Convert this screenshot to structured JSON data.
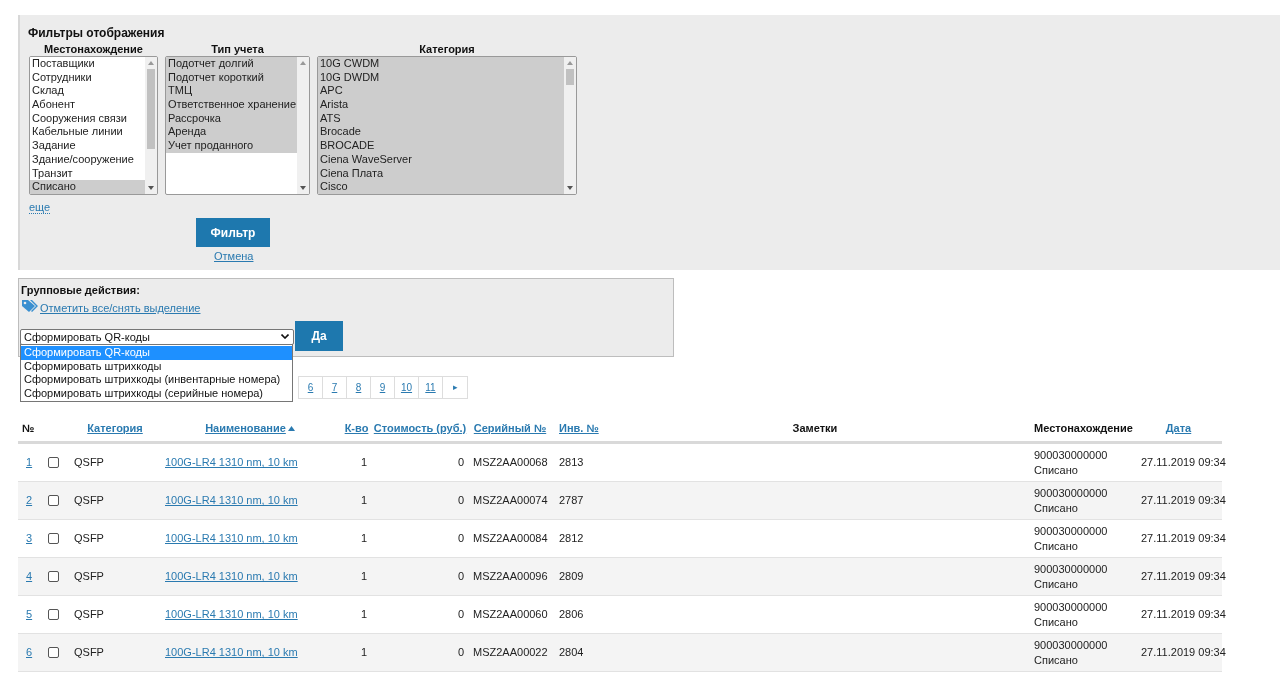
{
  "filters": {
    "title": "Фильтры отображения",
    "lists": [
      {
        "label": "Местонахождение",
        "items": [
          {
            "text": "Поставщики",
            "selected": false
          },
          {
            "text": "Сотрудники",
            "selected": false
          },
          {
            "text": "Склад",
            "selected": false
          },
          {
            "text": "Абонент",
            "selected": false
          },
          {
            "text": "Сооружения связи",
            "selected": false
          },
          {
            "text": "Кабельные линии",
            "selected": false
          },
          {
            "text": "Задание",
            "selected": false
          },
          {
            "text": "Здание/сооружение",
            "selected": false
          },
          {
            "text": "Транзит",
            "selected": false
          },
          {
            "text": "Списано",
            "selected": true
          }
        ]
      },
      {
        "label": "Тип учета",
        "items": [
          {
            "text": "Подотчет долгий",
            "selected": true
          },
          {
            "text": "Подотчет короткий",
            "selected": true
          },
          {
            "text": "ТМЦ",
            "selected": true
          },
          {
            "text": "Ответственное хранение",
            "selected": true
          },
          {
            "text": "Рассрочка",
            "selected": true
          },
          {
            "text": "Аренда",
            "selected": true
          },
          {
            "text": "Учет проданного",
            "selected": true
          }
        ]
      },
      {
        "label": "Категория",
        "items": [
          {
            "text": "10G CWDM",
            "selected": true
          },
          {
            "text": "10G DWDM",
            "selected": true
          },
          {
            "text": "APC",
            "selected": true
          },
          {
            "text": "Arista",
            "selected": true
          },
          {
            "text": "ATS",
            "selected": true
          },
          {
            "text": "Brocade",
            "selected": true
          },
          {
            "text": "BROCADE",
            "selected": true
          },
          {
            "text": "Ciena WaveServer",
            "selected": true
          },
          {
            "text": "Ciena Плата",
            "selected": true
          },
          {
            "text": "Cisco",
            "selected": true
          }
        ]
      }
    ],
    "more_link": "еще",
    "filter_button": "Фильтр",
    "cancel_link": "Отмена"
  },
  "group_actions": {
    "title": "Групповые действия:",
    "select_all_link": "Отметить все/снять выделение",
    "select_value": "Сформировать QR-коды",
    "go_button": "Да",
    "options": [
      {
        "text": "Сформировать QR-коды",
        "selected": true
      },
      {
        "text": "Сформировать штрихкоды",
        "selected": false
      },
      {
        "text": "Сформировать штрихкоды (инвентарные номера)",
        "selected": false
      },
      {
        "text": "Сформировать штрихкоды (серийные номера)",
        "selected": false
      }
    ]
  },
  "pagination": {
    "pages": [
      "6",
      "7",
      "8",
      "9",
      "10",
      "11"
    ],
    "next": "▸"
  },
  "table": {
    "columns": [
      {
        "label": "№",
        "sortable": false
      },
      {
        "label": "Категория",
        "sortable": true
      },
      {
        "label": "Наименование",
        "sortable": true,
        "sorted": true
      },
      {
        "label": "К-во",
        "sortable": true
      },
      {
        "label": "Стоимость (руб.)",
        "sortable": true
      },
      {
        "label": "Серийный №",
        "sortable": true
      },
      {
        "label": "Инв. №",
        "sortable": true
      },
      {
        "label": "Заметки",
        "sortable": false
      },
      {
        "label": "Местонахождение",
        "sortable": false
      },
      {
        "label": "Дата",
        "sortable": true
      }
    ],
    "rows": [
      {
        "number": "1",
        "checked": false,
        "category": "QSFP",
        "name": "100G-LR4 1310 nm, 10 km",
        "quantity": "1",
        "cost": "0",
        "serial": "MSZ2AA00068",
        "inventory": "2813",
        "location_code": "900030000000",
        "location_status": "Списано",
        "date": "27.11.2019 09:34"
      },
      {
        "number": "2",
        "checked": false,
        "category": "QSFP",
        "name": "100G-LR4 1310 nm, 10 km",
        "quantity": "1",
        "cost": "0",
        "serial": "MSZ2AA00074",
        "inventory": "2787",
        "location_code": "900030000000",
        "location_status": "Списано",
        "date": "27.11.2019 09:34"
      },
      {
        "number": "3",
        "checked": false,
        "category": "QSFP",
        "name": "100G-LR4 1310 nm, 10 km",
        "quantity": "1",
        "cost": "0",
        "serial": "MSZ2AA00084",
        "inventory": "2812",
        "location_code": "900030000000",
        "location_status": "Списано",
        "date": "27.11.2019 09:34"
      },
      {
        "number": "4",
        "checked": false,
        "category": "QSFP",
        "name": "100G-LR4 1310 nm, 10 km",
        "quantity": "1",
        "cost": "0",
        "serial": "MSZ2AA00096",
        "inventory": "2809",
        "location_code": "900030000000",
        "location_status": "Списано",
        "date": "27.11.2019 09:34"
      },
      {
        "number": "5",
        "checked": false,
        "category": "QSFP",
        "name": "100G-LR4 1310 nm, 10 km",
        "quantity": "1",
        "cost": "0",
        "serial": "MSZ2AA00060",
        "inventory": "2806",
        "location_code": "900030000000",
        "location_status": "Списано",
        "date": "27.11.2019 09:34"
      },
      {
        "number": "6",
        "checked": false,
        "category": "QSFP",
        "name": "100G-LR4 1310 nm, 10 km",
        "quantity": "1",
        "cost": "0",
        "serial": "MSZ2AA00022",
        "inventory": "2804",
        "location_code": "900030000000",
        "location_status": "Списано",
        "date": "27.11.2019 09:34"
      }
    ]
  }
}
